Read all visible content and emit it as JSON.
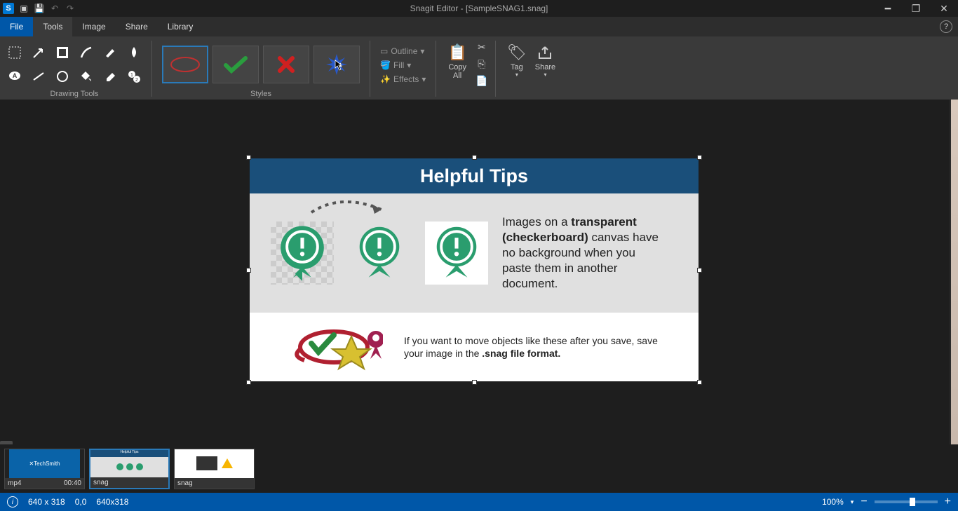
{
  "title": "Snagit Editor - [SampleSNAG1.snag]",
  "menu": {
    "file": "File",
    "tools": "Tools",
    "image": "Image",
    "share": "Share",
    "library": "Library"
  },
  "ribbon": {
    "drawing_label": "Drawing Tools",
    "styles_label": "Styles",
    "outline": "Outline",
    "fill": "Fill",
    "effects": "Effects",
    "copy": "Copy All",
    "tag": "Tag",
    "share": "Share"
  },
  "document": {
    "tips_title": "Helpful Tips",
    "tip1_a": "Images on a ",
    "tip1_b": "transparent (checkerboard)",
    "tip1_c": " canvas have no background when you paste them in another document.",
    "tip2_a": "If you want to move objects like these after you save, save your image in the ",
    "tip2_b": ".snag file format."
  },
  "thumbs": {
    "t1": {
      "type": "mp4",
      "time": "00:40"
    },
    "t2": {
      "type": "snag"
    },
    "t3": {
      "type": "snag"
    }
  },
  "status": {
    "dim": "640 x 318",
    "pos": "0,0",
    "dim2": "640x318",
    "zoom": "100%"
  }
}
